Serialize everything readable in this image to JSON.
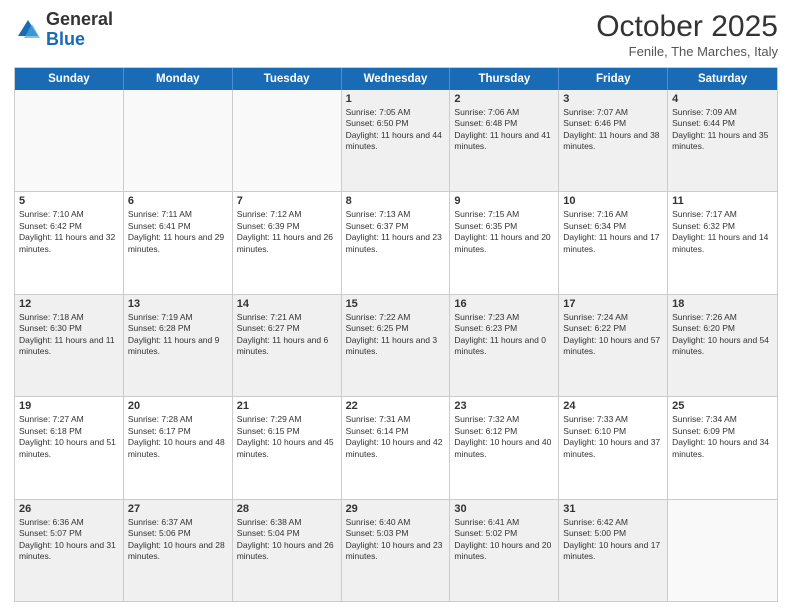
{
  "header": {
    "logo_general": "General",
    "logo_blue": "Blue",
    "month_title": "October 2025",
    "subtitle": "Fenile, The Marches, Italy"
  },
  "days_of_week": [
    "Sunday",
    "Monday",
    "Tuesday",
    "Wednesday",
    "Thursday",
    "Friday",
    "Saturday"
  ],
  "rows": [
    {
      "cells": [
        {
          "day": null,
          "empty": true
        },
        {
          "day": null,
          "empty": true
        },
        {
          "day": null,
          "empty": true
        },
        {
          "day": "1",
          "sunrise": "7:05 AM",
          "sunset": "6:50 PM",
          "daylight": "11 hours and 44 minutes."
        },
        {
          "day": "2",
          "sunrise": "7:06 AM",
          "sunset": "6:48 PM",
          "daylight": "11 hours and 41 minutes."
        },
        {
          "day": "3",
          "sunrise": "7:07 AM",
          "sunset": "6:46 PM",
          "daylight": "11 hours and 38 minutes."
        },
        {
          "day": "4",
          "sunrise": "7:09 AM",
          "sunset": "6:44 PM",
          "daylight": "11 hours and 35 minutes."
        }
      ]
    },
    {
      "cells": [
        {
          "day": "5",
          "sunrise": "7:10 AM",
          "sunset": "6:42 PM",
          "daylight": "11 hours and 32 minutes."
        },
        {
          "day": "6",
          "sunrise": "7:11 AM",
          "sunset": "6:41 PM",
          "daylight": "11 hours and 29 minutes."
        },
        {
          "day": "7",
          "sunrise": "7:12 AM",
          "sunset": "6:39 PM",
          "daylight": "11 hours and 26 minutes."
        },
        {
          "day": "8",
          "sunrise": "7:13 AM",
          "sunset": "6:37 PM",
          "daylight": "11 hours and 23 minutes."
        },
        {
          "day": "9",
          "sunrise": "7:15 AM",
          "sunset": "6:35 PM",
          "daylight": "11 hours and 20 minutes."
        },
        {
          "day": "10",
          "sunrise": "7:16 AM",
          "sunset": "6:34 PM",
          "daylight": "11 hours and 17 minutes."
        },
        {
          "day": "11",
          "sunrise": "7:17 AM",
          "sunset": "6:32 PM",
          "daylight": "11 hours and 14 minutes."
        }
      ]
    },
    {
      "cells": [
        {
          "day": "12",
          "sunrise": "7:18 AM",
          "sunset": "6:30 PM",
          "daylight": "11 hours and 11 minutes."
        },
        {
          "day": "13",
          "sunrise": "7:19 AM",
          "sunset": "6:28 PM",
          "daylight": "11 hours and 9 minutes."
        },
        {
          "day": "14",
          "sunrise": "7:21 AM",
          "sunset": "6:27 PM",
          "daylight": "11 hours and 6 minutes."
        },
        {
          "day": "15",
          "sunrise": "7:22 AM",
          "sunset": "6:25 PM",
          "daylight": "11 hours and 3 minutes."
        },
        {
          "day": "16",
          "sunrise": "7:23 AM",
          "sunset": "6:23 PM",
          "daylight": "11 hours and 0 minutes."
        },
        {
          "day": "17",
          "sunrise": "7:24 AM",
          "sunset": "6:22 PM",
          "daylight": "10 hours and 57 minutes."
        },
        {
          "day": "18",
          "sunrise": "7:26 AM",
          "sunset": "6:20 PM",
          "daylight": "10 hours and 54 minutes."
        }
      ]
    },
    {
      "cells": [
        {
          "day": "19",
          "sunrise": "7:27 AM",
          "sunset": "6:18 PM",
          "daylight": "10 hours and 51 minutes."
        },
        {
          "day": "20",
          "sunrise": "7:28 AM",
          "sunset": "6:17 PM",
          "daylight": "10 hours and 48 minutes."
        },
        {
          "day": "21",
          "sunrise": "7:29 AM",
          "sunset": "6:15 PM",
          "daylight": "10 hours and 45 minutes."
        },
        {
          "day": "22",
          "sunrise": "7:31 AM",
          "sunset": "6:14 PM",
          "daylight": "10 hours and 42 minutes."
        },
        {
          "day": "23",
          "sunrise": "7:32 AM",
          "sunset": "6:12 PM",
          "daylight": "10 hours and 40 minutes."
        },
        {
          "day": "24",
          "sunrise": "7:33 AM",
          "sunset": "6:10 PM",
          "daylight": "10 hours and 37 minutes."
        },
        {
          "day": "25",
          "sunrise": "7:34 AM",
          "sunset": "6:09 PM",
          "daylight": "10 hours and 34 minutes."
        }
      ]
    },
    {
      "cells": [
        {
          "day": "26",
          "sunrise": "6:36 AM",
          "sunset": "5:07 PM",
          "daylight": "10 hours and 31 minutes."
        },
        {
          "day": "27",
          "sunrise": "6:37 AM",
          "sunset": "5:06 PM",
          "daylight": "10 hours and 28 minutes."
        },
        {
          "day": "28",
          "sunrise": "6:38 AM",
          "sunset": "5:04 PM",
          "daylight": "10 hours and 26 minutes."
        },
        {
          "day": "29",
          "sunrise": "6:40 AM",
          "sunset": "5:03 PM",
          "daylight": "10 hours and 23 minutes."
        },
        {
          "day": "30",
          "sunrise": "6:41 AM",
          "sunset": "5:02 PM",
          "daylight": "10 hours and 20 minutes."
        },
        {
          "day": "31",
          "sunrise": "6:42 AM",
          "sunset": "5:00 PM",
          "daylight": "10 hours and 17 minutes."
        },
        {
          "day": null,
          "empty": true
        }
      ]
    }
  ]
}
